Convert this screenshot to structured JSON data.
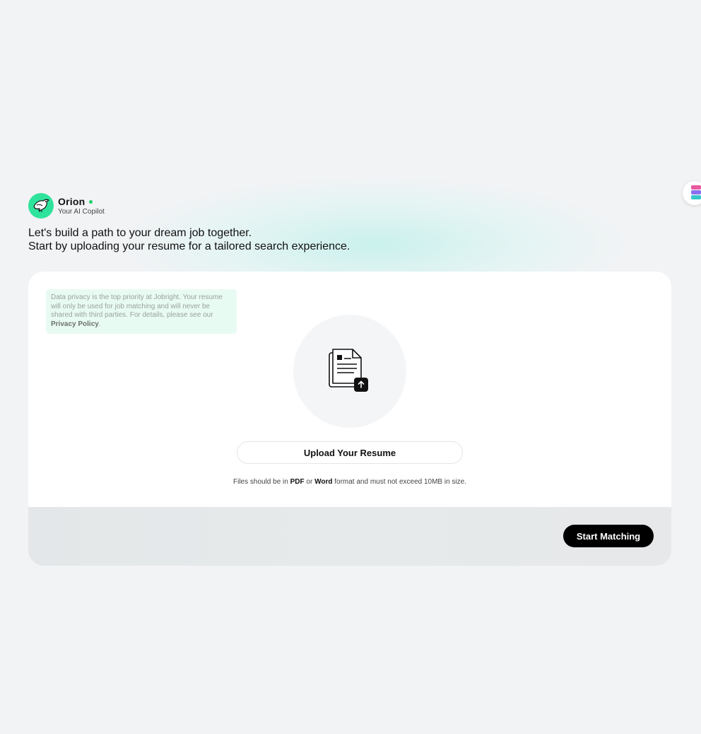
{
  "assistant": {
    "name": "Orion",
    "subtitle": "Your AI Copilot",
    "status_color": "#1fd16b",
    "avatar_color": "#2fe39c"
  },
  "intro": {
    "line1": "Let's build a path to your dream job together.",
    "line2": "Start by uploading your resume for a tailored search experience."
  },
  "privacy_notice": {
    "text": "Data privacy is the top priority at Jobright. Your resume will only be used for job matching and will never be shared with third parties. For details, please see our",
    "link_label": "Privacy Policy",
    "trailing": "."
  },
  "upload": {
    "icon": "resume-upload-icon",
    "button_label": "Upload Your Resume",
    "note_prefix": "Files should be in",
    "format_pdf": "PDF",
    "note_or": "or",
    "format_word": "Word",
    "note_suffix": "format and must not exceed 10MB in size."
  },
  "footer": {
    "start_label": "Start Matching"
  },
  "colors": {
    "background": "#f2f3f5",
    "card": "#ffffff",
    "primary_button": "#000000",
    "privacy_bg": "#e8fbf2"
  }
}
